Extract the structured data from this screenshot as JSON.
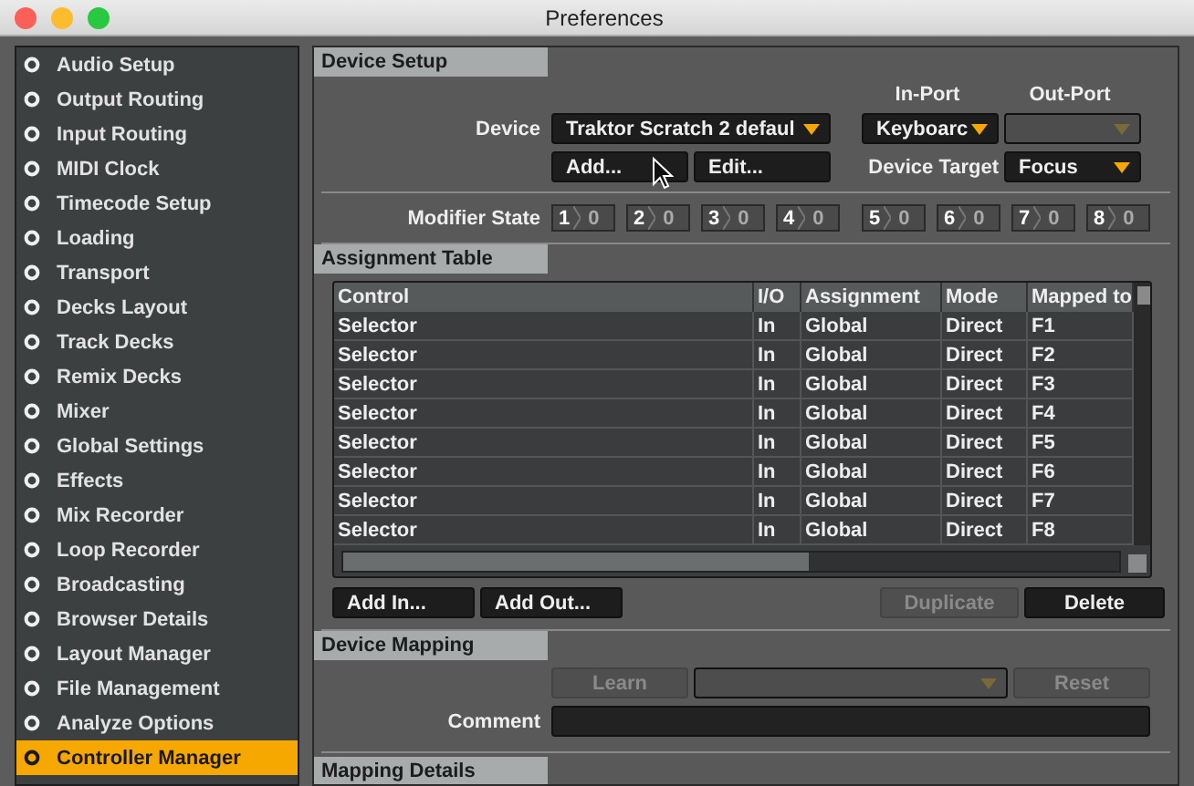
{
  "window": {
    "title": "Preferences"
  },
  "sidebar": {
    "items": [
      {
        "label": "Audio Setup",
        "selected": false
      },
      {
        "label": "Output Routing",
        "selected": false
      },
      {
        "label": "Input Routing",
        "selected": false
      },
      {
        "label": "MIDI Clock",
        "selected": false
      },
      {
        "label": "Timecode Setup",
        "selected": false
      },
      {
        "label": "Loading",
        "selected": false
      },
      {
        "label": "Transport",
        "selected": false
      },
      {
        "label": "Decks Layout",
        "selected": false
      },
      {
        "label": "Track Decks",
        "selected": false
      },
      {
        "label": "Remix Decks",
        "selected": false
      },
      {
        "label": "Mixer",
        "selected": false
      },
      {
        "label": "Global Settings",
        "selected": false
      },
      {
        "label": "Effects",
        "selected": false
      },
      {
        "label": "Mix Recorder",
        "selected": false
      },
      {
        "label": "Loop Recorder",
        "selected": false
      },
      {
        "label": "Broadcasting",
        "selected": false
      },
      {
        "label": "Browser Details",
        "selected": false
      },
      {
        "label": "Layout Manager",
        "selected": false
      },
      {
        "label": "File Management",
        "selected": false
      },
      {
        "label": "Analyze Options",
        "selected": false
      },
      {
        "label": "Controller Manager",
        "selected": true
      }
    ]
  },
  "device_setup": {
    "title": "Device Setup",
    "in_port_label": "In-Port",
    "out_port_label": "Out-Port",
    "device_label": "Device",
    "device": "Traktor Scratch 2 defaul",
    "in_port": "Keyboarc",
    "out_port": {
      "disabled": true
    },
    "add_button": "Add...",
    "edit_button": "Edit...",
    "device_target_label": "Device Target",
    "device_target": "Focus",
    "modifier_label": "Modifier State",
    "modifiers": [
      {
        "number": "1",
        "value": "0"
      },
      {
        "number": "2",
        "value": "0"
      },
      {
        "number": "3",
        "value": "0"
      },
      {
        "number": "4",
        "value": "0"
      },
      {
        "number": "5",
        "value": "0"
      },
      {
        "number": "6",
        "value": "0"
      },
      {
        "number": "7",
        "value": "0"
      },
      {
        "number": "8",
        "value": "0"
      }
    ]
  },
  "assignment_table": {
    "title": "Assignment Table",
    "columns": [
      "Control",
      "I/O",
      "Assignment",
      "Mode",
      "Mapped to"
    ],
    "rows": [
      [
        "Selector",
        "In",
        "Global",
        "Direct",
        "F1"
      ],
      [
        "Selector",
        "In",
        "Global",
        "Direct",
        "F2"
      ],
      [
        "Selector",
        "In",
        "Global",
        "Direct",
        "F3"
      ],
      [
        "Selector",
        "In",
        "Global",
        "Direct",
        "F4"
      ],
      [
        "Selector",
        "In",
        "Global",
        "Direct",
        "F5"
      ],
      [
        "Selector",
        "In",
        "Global",
        "Direct",
        "F6"
      ],
      [
        "Selector",
        "In",
        "Global",
        "Direct",
        "F7"
      ],
      [
        "Selector",
        "In",
        "Global",
        "Direct",
        "F8"
      ]
    ],
    "buttons": [
      {
        "label": "Add In...",
        "disabled": false
      },
      {
        "label": "Add Out...",
        "disabled": false
      },
      {
        "label": "Duplicate",
        "disabled": true
      },
      {
        "label": "Delete",
        "disabled": false
      }
    ]
  },
  "device_mapping": {
    "title": "Device Mapping",
    "learn_button": {
      "label": "Learn",
      "disabled": true
    },
    "reset_button": {
      "label": "Reset",
      "disabled": true
    },
    "comment_label": "Comment"
  },
  "mapping_details": {
    "title": "Mapping Details"
  }
}
